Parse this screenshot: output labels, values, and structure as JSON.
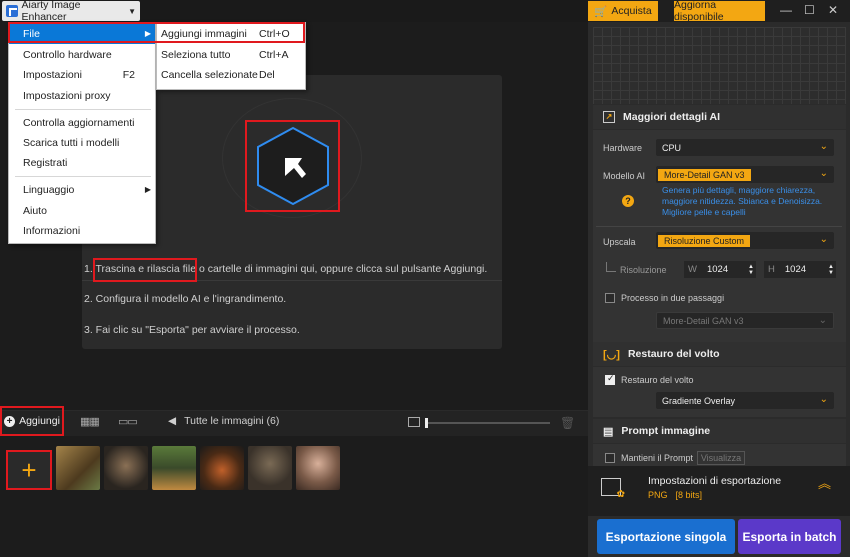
{
  "app": {
    "title": "Aiarty Image Enhancer"
  },
  "menu": {
    "items": [
      {
        "label": "File",
        "shortcut": ""
      },
      {
        "label": "Controllo hardware",
        "shortcut": ""
      },
      {
        "label": "Impostazioni",
        "shortcut": "F2"
      },
      {
        "label": "Impostazioni proxy",
        "shortcut": ""
      },
      {
        "label": "Controlla aggiornamenti",
        "shortcut": ""
      },
      {
        "label": "Scarica tutti i modelli",
        "shortcut": ""
      },
      {
        "label": "Registrati",
        "shortcut": ""
      },
      {
        "label": "Linguaggio",
        "shortcut": ""
      },
      {
        "label": "Aiuto",
        "shortcut": ""
      },
      {
        "label": "Informazioni",
        "shortcut": ""
      }
    ]
  },
  "submenu": {
    "items": [
      {
        "label": "Aggiungi immagini",
        "shortcut": "Ctrl+O"
      },
      {
        "label": "Seleziona tutto",
        "shortcut": "Ctrl+A"
      },
      {
        "label": "Cancella selezionate",
        "shortcut": "Del"
      }
    ]
  },
  "instructions": {
    "step1": "1. Trascina e rilascia file o cartelle di immagini qui, oppure clicca sul pulsante Aggiungi.",
    "step2": "2. Configura il modello AI e l'ingrandimento.",
    "step3": "3. Fai clic su \"Esporta\" per avviare il processo."
  },
  "bottom": {
    "add_label": "Aggiungi",
    "all_images_label": "Tutte le immagini (6)",
    "thumbnails": [
      {
        "name": "tiger",
        "color": "#8a6a3a"
      },
      {
        "name": "bird",
        "color": "#5a4a35"
      },
      {
        "name": "figure",
        "color": "#3f5a3a"
      },
      {
        "name": "burger",
        "color": "#6a3a22"
      },
      {
        "name": "portrait-dark",
        "color": "#4a4038"
      },
      {
        "name": "portrait-woman",
        "color": "#b08a78"
      }
    ]
  },
  "topbar": {
    "buy_label": "Acquista",
    "update_label": "Aggiorna disponibile"
  },
  "ai_details": {
    "title": "Maggiori dettagli AI",
    "hardware_label": "Hardware",
    "hardware_value": "CPU",
    "model_label": "Modello AI",
    "model_value": "More-Detail GAN  v3",
    "model_desc": "Genera più dettagli, maggiore chiarezza, maggiore nitidezza. Sbianca e Denoisizza. Migliore pelle e capelli",
    "upscale_label": "Upscala",
    "upscale_value": "Risoluzione Custom",
    "resolution_label": "Risoluzione",
    "w_label": "W",
    "w_value": "1024",
    "h_label": "H",
    "h_value": "1024",
    "two_pass_label": "Processo in due passaggi",
    "two_pass_model": "More-Detail GAN  v3"
  },
  "face": {
    "title": "Restauro del volto",
    "check_label": "Restauro del volto",
    "mode_value": "Gradiente Overlay"
  },
  "prompt": {
    "title": "Prompt immagine",
    "keep_label": "Mantieni il Prompt",
    "view_label": "Visualizza"
  },
  "export": {
    "settings_title": "Impostazioni di esportazione",
    "format": "PNG",
    "bits": "[8 bits]",
    "single_label": "Esportazione singola",
    "batch_label": "Esporta in batch"
  },
  "colors": {
    "accent": "#f3a712",
    "highlight": "#e0191e",
    "blue": "#1a6fd0",
    "purple": "#5b39c9"
  }
}
